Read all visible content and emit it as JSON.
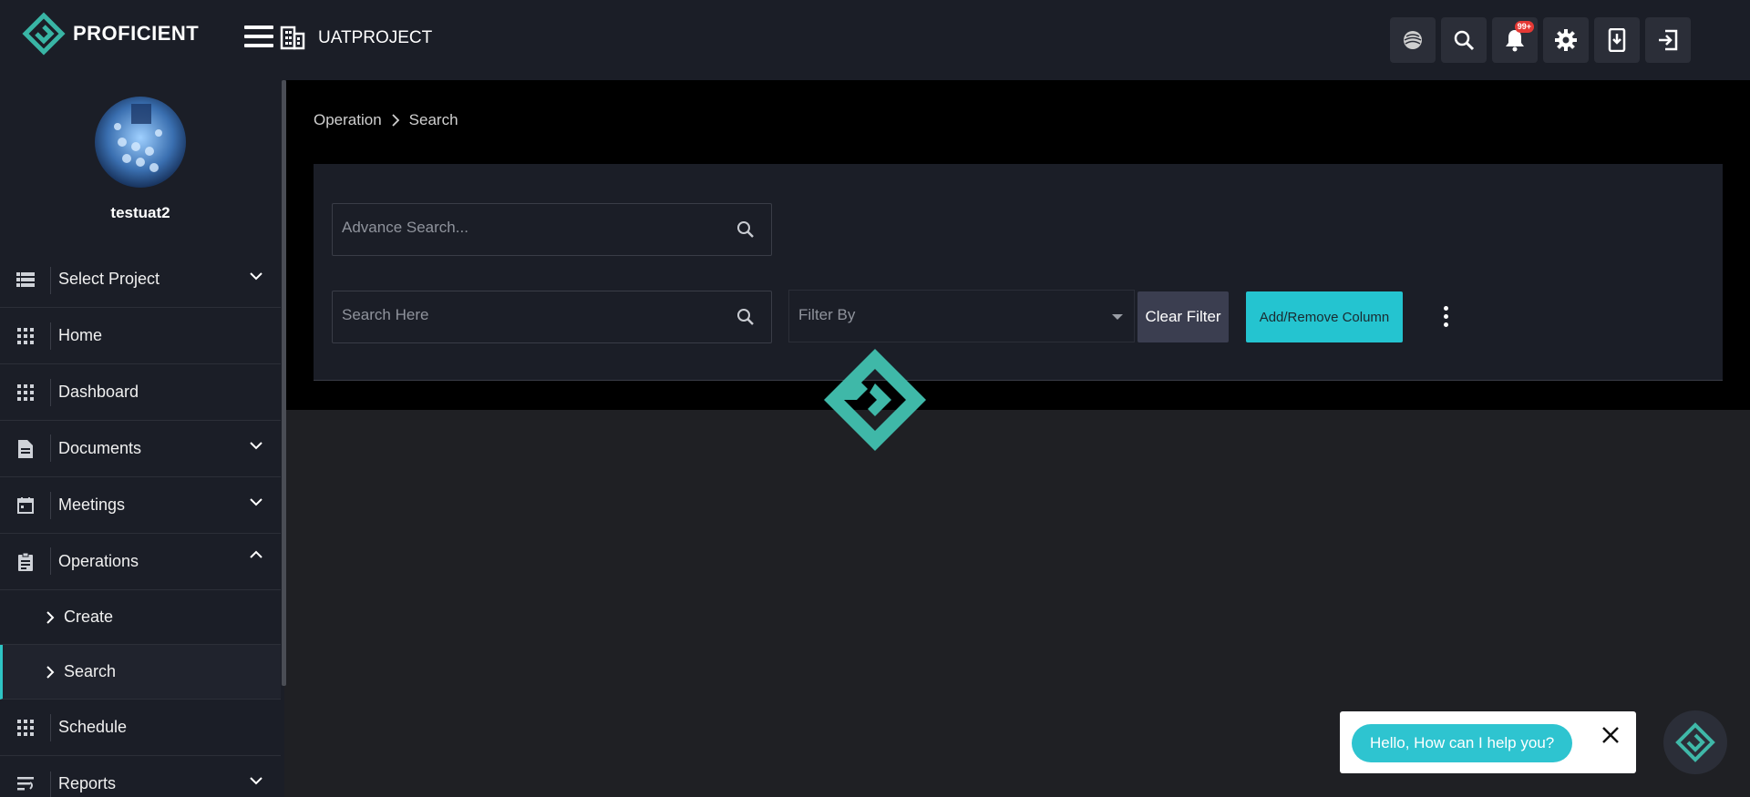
{
  "app": {
    "logo_text": "PROFICIENT",
    "project_name": "UATPROJECT",
    "notification_badge": "99+",
    "accent_color": "#2ec4c4"
  },
  "header_icons": [
    "globe-icon",
    "search-icon",
    "bell-icon",
    "gear-icon",
    "download-icon",
    "logout-icon"
  ],
  "user": {
    "name": "testuat2"
  },
  "sidebar": {
    "items": [
      {
        "label": "Select Project",
        "icon": "list-icon",
        "chevron": "down"
      },
      {
        "label": "Home",
        "icon": "grid-icon"
      },
      {
        "label": "Dashboard",
        "icon": "grid-icon"
      },
      {
        "label": "Documents",
        "icon": "document-icon",
        "chevron": "down"
      },
      {
        "label": "Meetings",
        "icon": "calendar-icon",
        "chevron": "down"
      },
      {
        "label": "Operations",
        "icon": "clipboard-icon",
        "chevron": "up"
      },
      {
        "label": "Create",
        "sub": true
      },
      {
        "label": "Search",
        "sub": true,
        "active": true
      },
      {
        "label": "Schedule",
        "icon": "grid-icon"
      },
      {
        "label": "Reports",
        "icon": "report-icon",
        "chevron": "down"
      }
    ]
  },
  "breadcrumb": {
    "parent": "Operation",
    "current": "Search"
  },
  "search": {
    "advance_placeholder": "Advance Search...",
    "search_placeholder": "Search Here",
    "filter_placeholder": "Filter By",
    "clear_filter_label": "Clear Filter",
    "add_remove_column_label": "Add/Remove Column"
  },
  "chat": {
    "greeting": "Hello, How can I help you?"
  }
}
